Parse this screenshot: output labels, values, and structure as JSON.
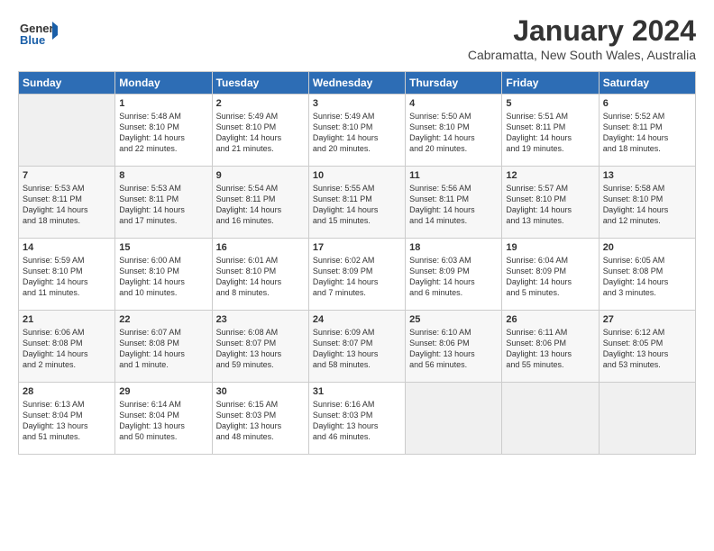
{
  "header": {
    "logo_general": "General",
    "logo_blue": "Blue",
    "title": "January 2024",
    "location": "Cabramatta, New South Wales, Australia"
  },
  "days_of_week": [
    "Sunday",
    "Monday",
    "Tuesday",
    "Wednesday",
    "Thursday",
    "Friday",
    "Saturday"
  ],
  "weeks": [
    [
      {
        "day": "",
        "info": ""
      },
      {
        "day": "1",
        "info": "Sunrise: 5:48 AM\nSunset: 8:10 PM\nDaylight: 14 hours\nand 22 minutes."
      },
      {
        "day": "2",
        "info": "Sunrise: 5:49 AM\nSunset: 8:10 PM\nDaylight: 14 hours\nand 21 minutes."
      },
      {
        "day": "3",
        "info": "Sunrise: 5:49 AM\nSunset: 8:10 PM\nDaylight: 14 hours\nand 20 minutes."
      },
      {
        "day": "4",
        "info": "Sunrise: 5:50 AM\nSunset: 8:10 PM\nDaylight: 14 hours\nand 20 minutes."
      },
      {
        "day": "5",
        "info": "Sunrise: 5:51 AM\nSunset: 8:11 PM\nDaylight: 14 hours\nand 19 minutes."
      },
      {
        "day": "6",
        "info": "Sunrise: 5:52 AM\nSunset: 8:11 PM\nDaylight: 14 hours\nand 18 minutes."
      }
    ],
    [
      {
        "day": "7",
        "info": "Sunrise: 5:53 AM\nSunset: 8:11 PM\nDaylight: 14 hours\nand 18 minutes."
      },
      {
        "day": "8",
        "info": "Sunrise: 5:53 AM\nSunset: 8:11 PM\nDaylight: 14 hours\nand 17 minutes."
      },
      {
        "day": "9",
        "info": "Sunrise: 5:54 AM\nSunset: 8:11 PM\nDaylight: 14 hours\nand 16 minutes."
      },
      {
        "day": "10",
        "info": "Sunrise: 5:55 AM\nSunset: 8:11 PM\nDaylight: 14 hours\nand 15 minutes."
      },
      {
        "day": "11",
        "info": "Sunrise: 5:56 AM\nSunset: 8:11 PM\nDaylight: 14 hours\nand 14 minutes."
      },
      {
        "day": "12",
        "info": "Sunrise: 5:57 AM\nSunset: 8:10 PM\nDaylight: 14 hours\nand 13 minutes."
      },
      {
        "day": "13",
        "info": "Sunrise: 5:58 AM\nSunset: 8:10 PM\nDaylight: 14 hours\nand 12 minutes."
      }
    ],
    [
      {
        "day": "14",
        "info": "Sunrise: 5:59 AM\nSunset: 8:10 PM\nDaylight: 14 hours\nand 11 minutes."
      },
      {
        "day": "15",
        "info": "Sunrise: 6:00 AM\nSunset: 8:10 PM\nDaylight: 14 hours\nand 10 minutes."
      },
      {
        "day": "16",
        "info": "Sunrise: 6:01 AM\nSunset: 8:10 PM\nDaylight: 14 hours\nand 8 minutes."
      },
      {
        "day": "17",
        "info": "Sunrise: 6:02 AM\nSunset: 8:09 PM\nDaylight: 14 hours\nand 7 minutes."
      },
      {
        "day": "18",
        "info": "Sunrise: 6:03 AM\nSunset: 8:09 PM\nDaylight: 14 hours\nand 6 minutes."
      },
      {
        "day": "19",
        "info": "Sunrise: 6:04 AM\nSunset: 8:09 PM\nDaylight: 14 hours\nand 5 minutes."
      },
      {
        "day": "20",
        "info": "Sunrise: 6:05 AM\nSunset: 8:08 PM\nDaylight: 14 hours\nand 3 minutes."
      }
    ],
    [
      {
        "day": "21",
        "info": "Sunrise: 6:06 AM\nSunset: 8:08 PM\nDaylight: 14 hours\nand 2 minutes."
      },
      {
        "day": "22",
        "info": "Sunrise: 6:07 AM\nSunset: 8:08 PM\nDaylight: 14 hours\nand 1 minute."
      },
      {
        "day": "23",
        "info": "Sunrise: 6:08 AM\nSunset: 8:07 PM\nDaylight: 13 hours\nand 59 minutes."
      },
      {
        "day": "24",
        "info": "Sunrise: 6:09 AM\nSunset: 8:07 PM\nDaylight: 13 hours\nand 58 minutes."
      },
      {
        "day": "25",
        "info": "Sunrise: 6:10 AM\nSunset: 8:06 PM\nDaylight: 13 hours\nand 56 minutes."
      },
      {
        "day": "26",
        "info": "Sunrise: 6:11 AM\nSunset: 8:06 PM\nDaylight: 13 hours\nand 55 minutes."
      },
      {
        "day": "27",
        "info": "Sunrise: 6:12 AM\nSunset: 8:05 PM\nDaylight: 13 hours\nand 53 minutes."
      }
    ],
    [
      {
        "day": "28",
        "info": "Sunrise: 6:13 AM\nSunset: 8:04 PM\nDaylight: 13 hours\nand 51 minutes."
      },
      {
        "day": "29",
        "info": "Sunrise: 6:14 AM\nSunset: 8:04 PM\nDaylight: 13 hours\nand 50 minutes."
      },
      {
        "day": "30",
        "info": "Sunrise: 6:15 AM\nSunset: 8:03 PM\nDaylight: 13 hours\nand 48 minutes."
      },
      {
        "day": "31",
        "info": "Sunrise: 6:16 AM\nSunset: 8:03 PM\nDaylight: 13 hours\nand 46 minutes."
      },
      {
        "day": "",
        "info": ""
      },
      {
        "day": "",
        "info": ""
      },
      {
        "day": "",
        "info": ""
      }
    ]
  ]
}
